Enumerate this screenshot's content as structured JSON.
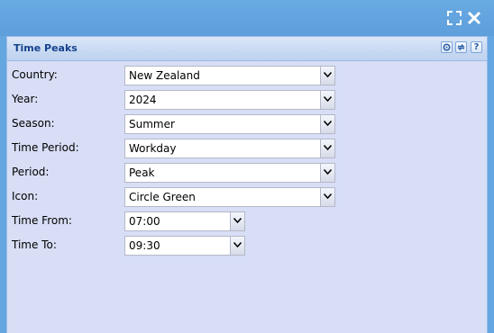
{
  "window": {
    "maximize_icon": "maximize-icon",
    "close_icon": "close-icon"
  },
  "panel": {
    "title": "Time Peaks",
    "tools": [
      "gear-icon",
      "refresh-icon",
      "help-icon"
    ],
    "help_glyph": "?"
  },
  "form": {
    "fields": [
      {
        "label": "Country:",
        "value": "New Zealand"
      },
      {
        "label": "Year:",
        "value": "2024"
      },
      {
        "label": "Season:",
        "value": "Summer"
      },
      {
        "label": "Time Period:",
        "value": "Workday"
      },
      {
        "label": "Period:",
        "value": "Peak"
      },
      {
        "label": "Icon:",
        "value": "Circle Green"
      },
      {
        "label": "Time From:",
        "value": "07:00"
      },
      {
        "label": "Time To:",
        "value": "09:30"
      }
    ]
  },
  "colors": {
    "titlebar": "#63a6e0",
    "panel_bg": "#d7def5",
    "header_text": "#15428b",
    "border": "#99bbe8"
  }
}
